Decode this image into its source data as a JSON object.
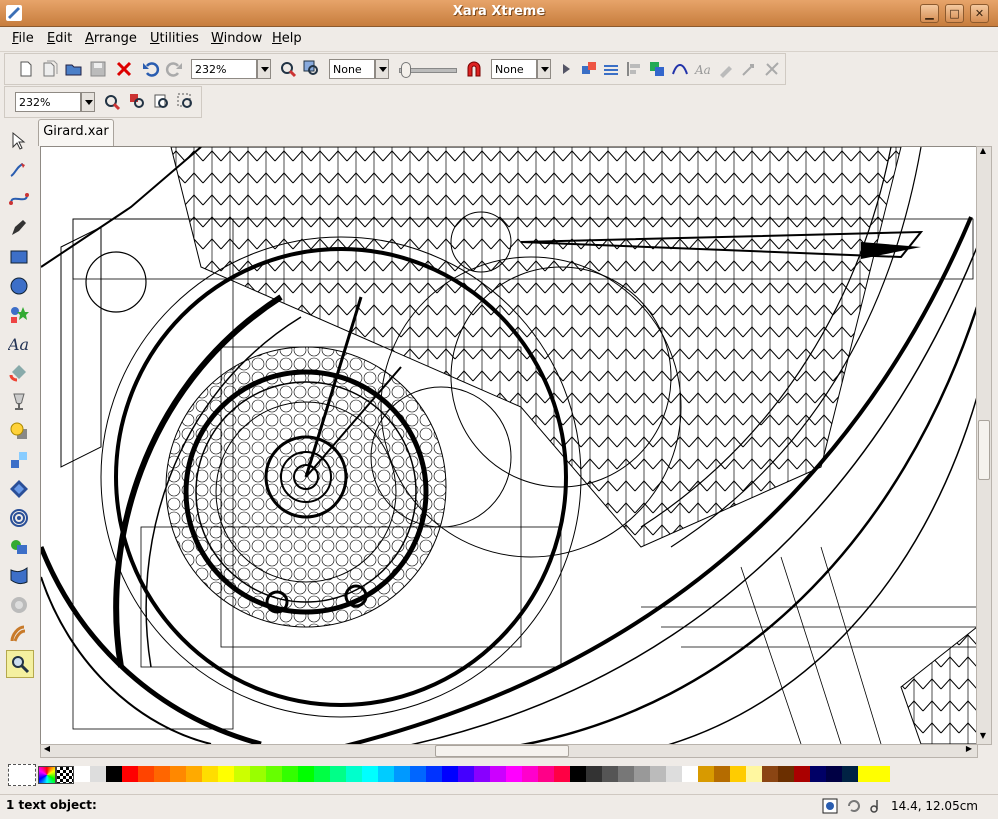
{
  "window": {
    "title": "Xara Xtreme"
  },
  "menu": {
    "items": [
      {
        "label": "File",
        "key": "F",
        "rest": "ile"
      },
      {
        "label": "Edit",
        "key": "E",
        "rest": "dit"
      },
      {
        "label": "Arrange",
        "key": "A",
        "rest": "rrange"
      },
      {
        "label": "Utilities",
        "key": "U",
        "rest": "tilities"
      },
      {
        "label": "Window",
        "key": "W",
        "rest": "indow"
      },
      {
        "label": "Help",
        "key": "H",
        "rest": "elp"
      }
    ]
  },
  "toolbar1": {
    "zoom_value": "232%",
    "quality_value": "None",
    "snap_value": "None"
  },
  "toolbar2": {
    "zoom_value": "232%"
  },
  "document": {
    "tab_label": "Girard.xar"
  },
  "palette": {
    "colors": [
      "#ffffff",
      "#dddddd",
      "#000000",
      "#ff0000",
      "#ff4400",
      "#ff6600",
      "#ff8800",
      "#ffaa00",
      "#ffdd00",
      "#ffff00",
      "#ccff00",
      "#99ff00",
      "#66ff00",
      "#33ff00",
      "#00ff00",
      "#00ff44",
      "#00ff88",
      "#00ffcc",
      "#00ffff",
      "#00ccff",
      "#0099ff",
      "#0066ff",
      "#0033ff",
      "#0000ff",
      "#4400ff",
      "#8800ff",
      "#cc00ff",
      "#ff00ff",
      "#ff00cc",
      "#ff0088",
      "#ff0044",
      "#000000",
      "#333333",
      "#555555",
      "#777777",
      "#999999",
      "#bbbbbb",
      "#dddddd",
      "#ffffff",
      "#d89a00",
      "#b56c00",
      "#ffcc00",
      "#fff7a0",
      "#8b4513",
      "#6b2f00",
      "#aa0000",
      "#000066",
      "#000044",
      "#002244",
      "#ffff00",
      "#ffff00"
    ]
  },
  "status": {
    "selection_text": "1 text object:",
    "coords": "14.4, 12.05cm"
  }
}
